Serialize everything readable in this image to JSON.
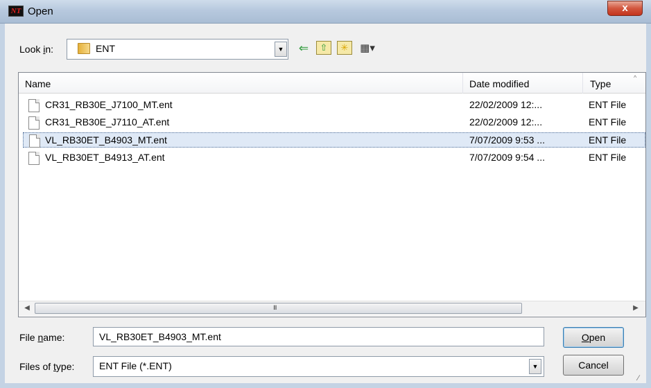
{
  "window": {
    "title": "Open",
    "app_icon_text": "NT",
    "close_glyph": "x"
  },
  "lookin": {
    "label_prefix": "Look ",
    "label_accel": "i",
    "label_suffix": "n:",
    "value": "ENT",
    "icons": [
      "back-arrow-icon",
      "up-folder-icon",
      "new-folder-icon",
      "view-menu-icon"
    ]
  },
  "list": {
    "columns": [
      "Name",
      "Date modified",
      "Type"
    ],
    "rows": [
      {
        "name": "CR31_RB30E_J7100_MT.ent",
        "date": "22/02/2009 12:...",
        "type": "ENT File",
        "selected": false
      },
      {
        "name": "CR31_RB30E_J7110_AT.ent",
        "date": "22/02/2009 12:...",
        "type": "ENT File",
        "selected": false
      },
      {
        "name": "VL_RB30ET_B4903_MT.ent",
        "date": "7/07/2009 9:53 ...",
        "type": "ENT File",
        "selected": true
      },
      {
        "name": "VL_RB30ET_B4913_AT.ent",
        "date": "7/07/2009 9:54 ...",
        "type": "ENT File",
        "selected": false
      }
    ],
    "scroll_grip": "III"
  },
  "filename": {
    "label_prefix": "File ",
    "label_accel": "n",
    "label_suffix": "ame:",
    "value": "VL_RB30ET_B4903_MT.ent"
  },
  "filetype": {
    "label_prefix": "Files of ",
    "label_accel": "t",
    "label_suffix": "ype:",
    "value": "ENT File (*.ENT)"
  },
  "buttons": {
    "open_accel": "O",
    "open_rest": "pen",
    "cancel": "Cancel"
  },
  "colors": {
    "selection": "#dfe9f6",
    "close_button": "#c3341d",
    "titlebar": "#b7c9de"
  }
}
